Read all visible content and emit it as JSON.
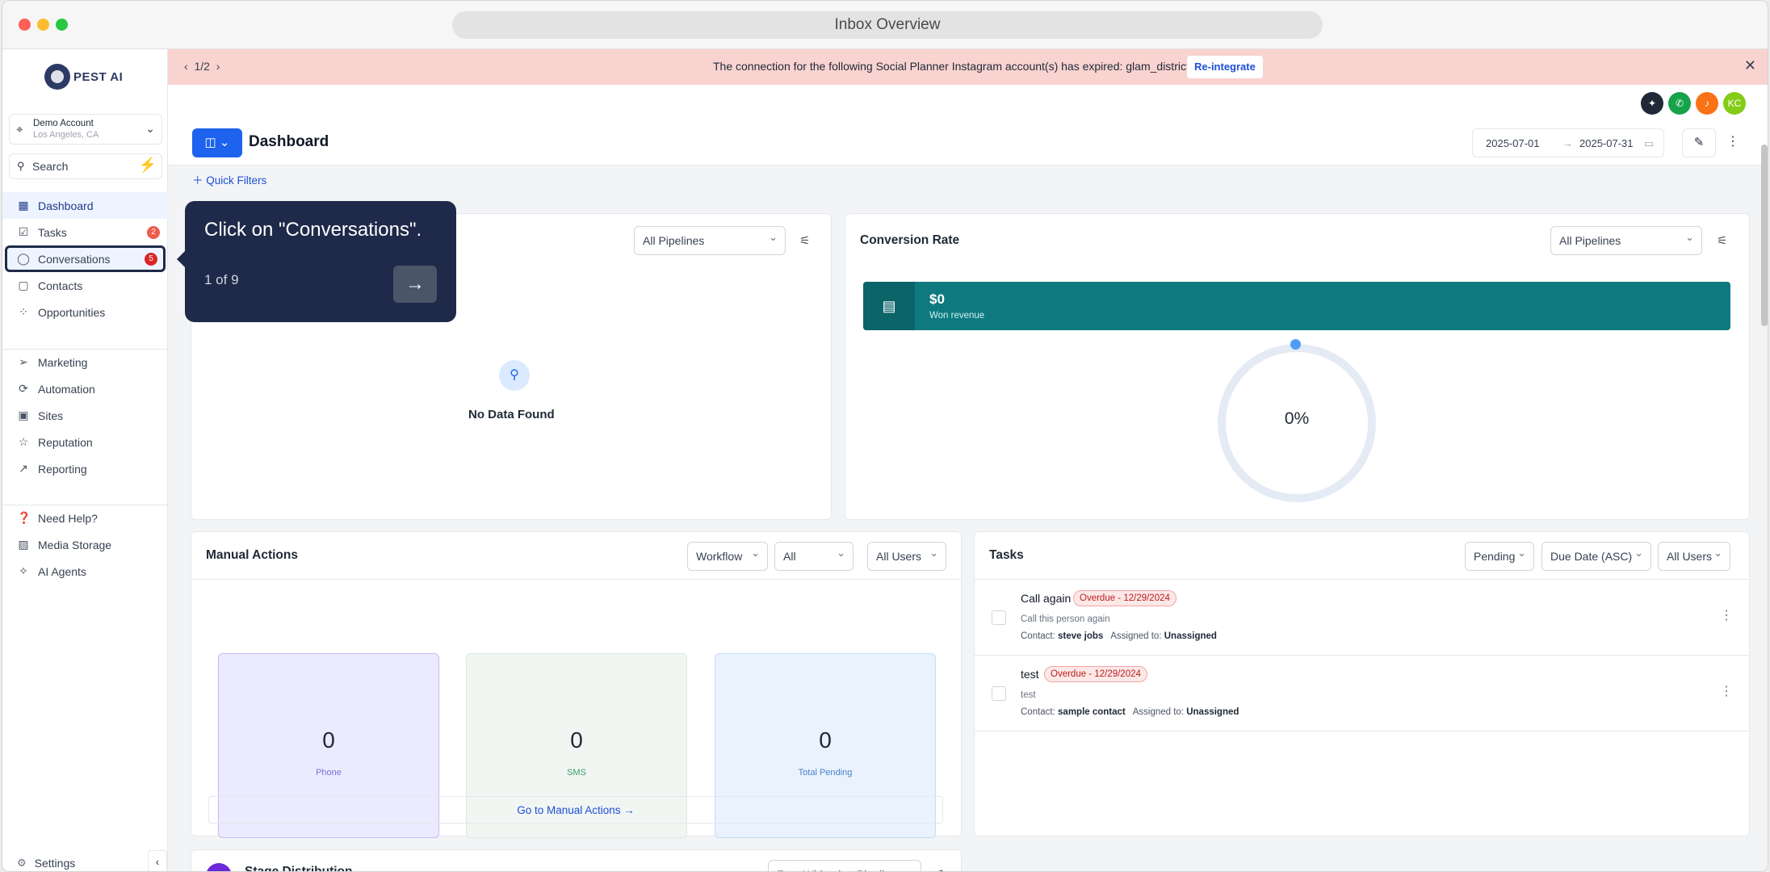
{
  "window": {
    "title": "Inbox Overview"
  },
  "sidebar": {
    "logo_text": "PEST AI",
    "account": {
      "name": "Demo Account",
      "location": "Los Angeles, CA"
    },
    "search_placeholder": "Search",
    "items": [
      {
        "label": "Dashboard",
        "icon": "grid-icon"
      },
      {
        "label": "Tasks",
        "icon": "check-icon",
        "badge": "2"
      },
      {
        "label": "Conversations",
        "icon": "chat-icon",
        "badge": "5"
      },
      {
        "label": "Contacts",
        "icon": "contacts-icon"
      },
      {
        "label": "Opportunities",
        "icon": "opportunities-icon"
      },
      {
        "label": "Marketing",
        "icon": "send-icon"
      },
      {
        "label": "Automation",
        "icon": "automation-icon"
      },
      {
        "label": "Sites",
        "icon": "sites-icon"
      },
      {
        "label": "Reputation",
        "icon": "star-icon"
      },
      {
        "label": "Reporting",
        "icon": "trend-icon"
      },
      {
        "label": "Need Help?",
        "icon": "help-icon"
      },
      {
        "label": "Media Storage",
        "icon": "image-icon"
      },
      {
        "label": "AI Agents",
        "icon": "ai-icon"
      }
    ],
    "settings_label": "Settings"
  },
  "banner": {
    "pager": "1/2",
    "message": "The connection for the following Social Planner Instagram account(s) has expired: glam_district.",
    "action": "Re-integrate"
  },
  "topbar": {
    "avatar_initials": "KC"
  },
  "header": {
    "title": "Dashboard",
    "date_start": "2025-07-01",
    "date_end": "2025-07-31",
    "quick_filters": "Quick Filters"
  },
  "opportunity_card": {
    "pipeline_select": "All Pipelines",
    "empty_text": "No Data Found"
  },
  "conversion_card": {
    "title": "Conversion Rate",
    "pipeline_select": "All Pipelines",
    "won_amount": "$0",
    "won_label": "Won revenue",
    "rate": "0%"
  },
  "manual_actions": {
    "title": "Manual Actions",
    "filters": [
      "Workflow",
      "All",
      "All Users"
    ],
    "stats": [
      {
        "value": "0",
        "label": "Phone"
      },
      {
        "value": "0",
        "label": "SMS"
      },
      {
        "value": "0",
        "label": "Total Pending"
      }
    ],
    "goto_label": "Go to Manual Actions →"
  },
  "tasks_card": {
    "title": "Tasks",
    "filters": [
      "Pending",
      "Due Date (ASC)",
      "All Users"
    ],
    "items": [
      {
        "title": "Call again",
        "status": "Overdue - 12/29/2024",
        "desc": "Call this person again",
        "contact_label": "Contact:",
        "contact": "steve jobs",
        "assigned_label": "Assigned to:",
        "assigned": "Unassigned"
      },
      {
        "title": "test",
        "status": "Overdue - 12/29/2024",
        "desc": "test",
        "contact_label": "Contact:",
        "contact": "sample contact",
        "assigned_label": "Assigned to:",
        "assigned": "Unassigned"
      }
    ]
  },
  "stage_card": {
    "title": "Stage Distribution",
    "pipeline_select": "Free Whitening Pipeline"
  },
  "tooltip": {
    "message": "Click on \"Conversations\".",
    "step": "1 of 9"
  },
  "colors": {
    "accent": "#1d63ed",
    "tooltip_bg": "#1f2a4a",
    "won_bg": "#0e7a7f",
    "banner_bg": "#f8d3d0"
  }
}
